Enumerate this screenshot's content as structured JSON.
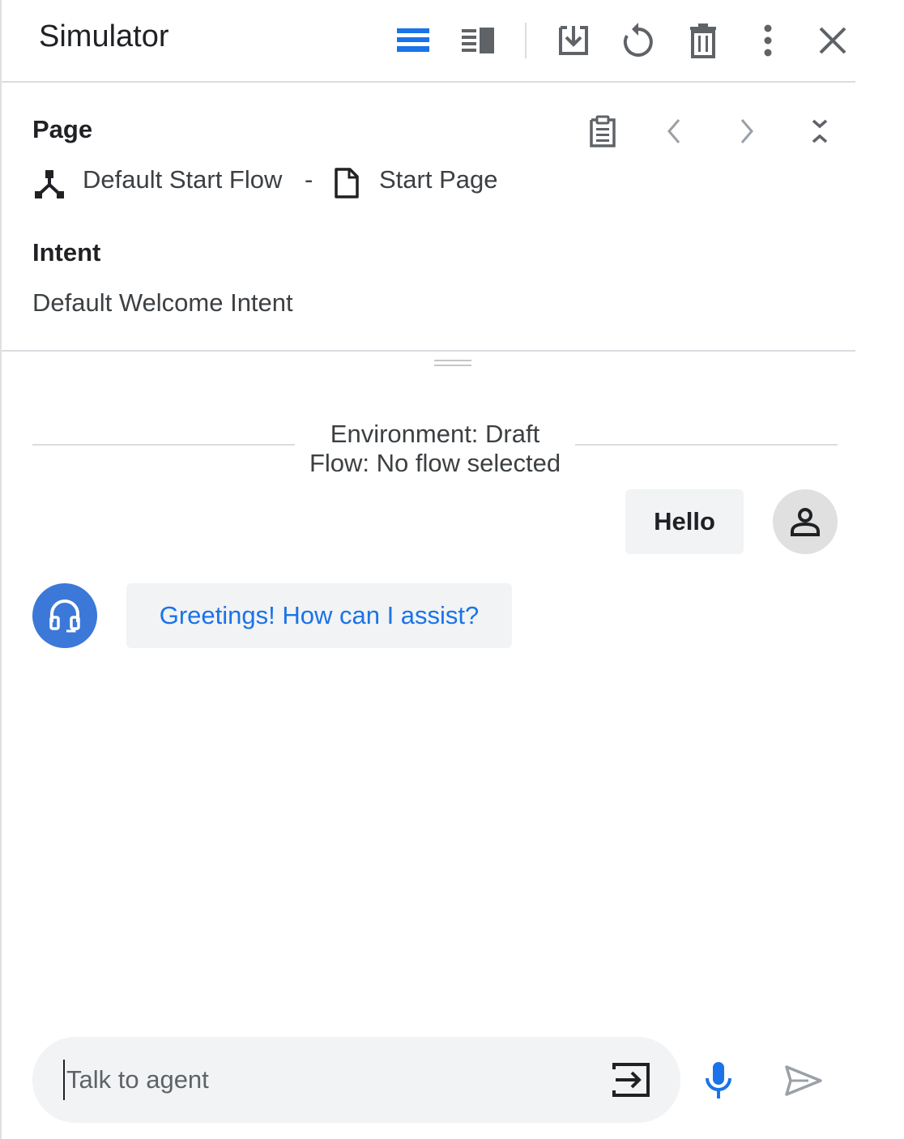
{
  "header": {
    "title": "Simulator",
    "icons": [
      "view-stacked-icon",
      "view-split-icon",
      "download-icon",
      "reset-icon",
      "delete-icon",
      "more-vert-icon",
      "close-icon"
    ]
  },
  "page_section": {
    "label": "Page",
    "flow_name": "Default Start Flow",
    "separator": "-",
    "page_name": "Start Page"
  },
  "intent_section": {
    "label": "Intent",
    "value": "Default Welcome Intent"
  },
  "conversation": {
    "environment_line": "Environment: Draft",
    "flow_line": "Flow: No flow selected",
    "user_message": "Hello",
    "agent_message": "Greetings! How can I assist?"
  },
  "input": {
    "placeholder": "Talk to agent",
    "value": ""
  },
  "colors": {
    "accent": "#1a73e8",
    "agent_avatar": "#3c78d8",
    "bubble_bg": "#f1f3f4"
  }
}
